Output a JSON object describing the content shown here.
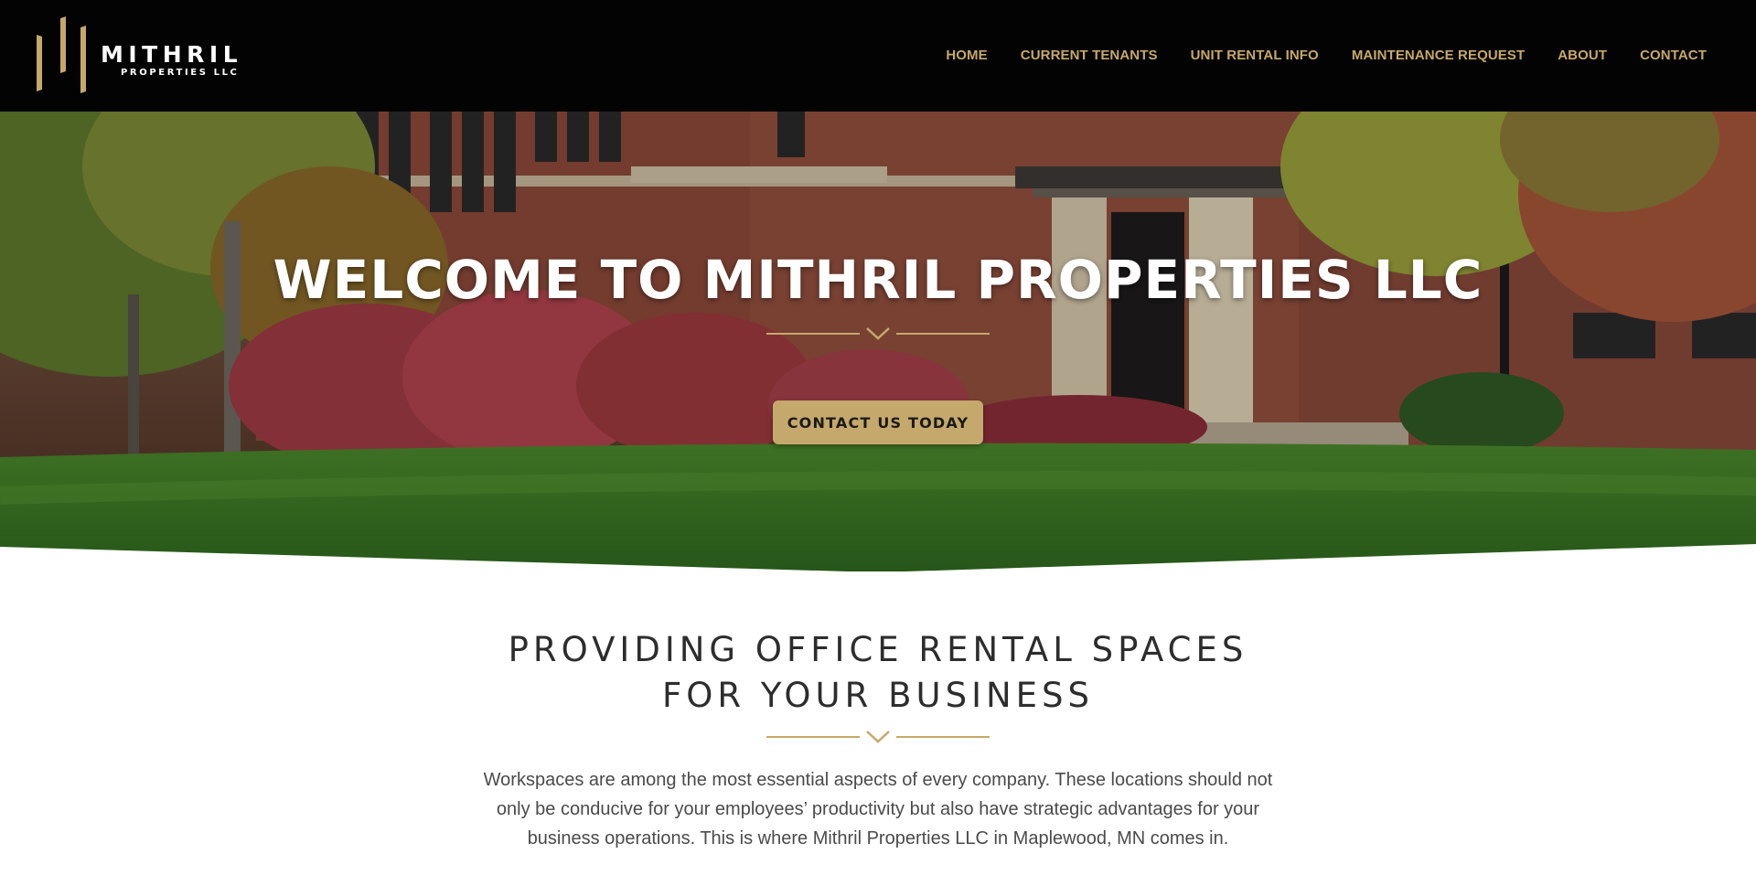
{
  "brand": {
    "name": "MITHRIL",
    "tagline": "PROPERTIES LLC",
    "accent_color": "#c6a86a",
    "header_bg": "#030303"
  },
  "nav": {
    "items": [
      {
        "label": "HOME"
      },
      {
        "label": "CURRENT TENANTS"
      },
      {
        "label": "UNIT RENTAL INFO"
      },
      {
        "label": "MAINTENANCE REQUEST"
      },
      {
        "label": "ABOUT"
      },
      {
        "label": "CONTACT"
      }
    ]
  },
  "hero": {
    "title": "WELCOME TO MITHRIL PROPERTIES LLC",
    "cta_label": "CONTACT US TODAY",
    "divider_icon": "chevron-down-icon"
  },
  "content": {
    "heading_line1": "PROVIDING OFFICE RENTAL SPACES",
    "heading_line2": "FOR YOUR BUSINESS",
    "divider_icon": "chevron-down-icon",
    "paragraph": "Workspaces are among the most essential aspects of every company. These locations should not only be conducive for your employees’ productivity but also have strategic advantages for your business operations. This is where Mithril Properties LLC in Maplewood, MN comes in."
  }
}
